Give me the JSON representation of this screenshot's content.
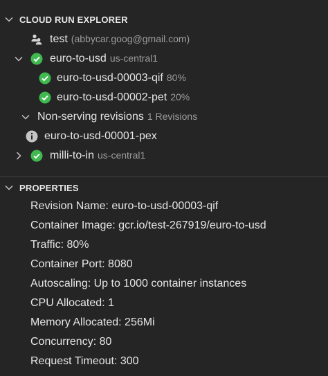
{
  "explorer": {
    "title": "CLOUD RUN EXPLORER",
    "account": {
      "label": "test",
      "email": "(abbycar.goog@gmail.com)"
    },
    "services": [
      {
        "name": "euro-to-usd",
        "region": "us-central1",
        "revisions": [
          {
            "name": "euro-to-usd-00003-qif",
            "traffic": "80%"
          },
          {
            "name": "euro-to-usd-00002-pet",
            "traffic": "20%"
          }
        ],
        "non_serving": {
          "label": "Non-serving revisions",
          "count": "1 Revisions",
          "items": [
            {
              "name": "euro-to-usd-00001-pex"
            }
          ]
        }
      },
      {
        "name": "milli-to-in",
        "region": "us-central1"
      }
    ]
  },
  "properties": {
    "title": "PROPERTIES",
    "items": [
      "Revision Name: euro-to-usd-00003-qif",
      "Container Image: gcr.io/test-267919/euro-to-usd",
      "Traffic: 80%",
      "Container Port: 8080",
      "Autoscaling: Up to 1000 container instances",
      "CPU Allocated: 1",
      "Memory Allocated: 256Mi",
      "Concurrency: 80",
      "Request Timeout: 300"
    ]
  },
  "colors": {
    "background": "#252526",
    "status_ok": "#3fb950",
    "info_icon": "#c5c5c5",
    "description": "#9d9d9d"
  },
  "icons": {
    "section_chevron": "chevron-down-icon",
    "account": "people-icon",
    "service_ok": "check-circle-icon",
    "info": "info-circle-icon",
    "collapsed": "chevron-right-icon"
  }
}
